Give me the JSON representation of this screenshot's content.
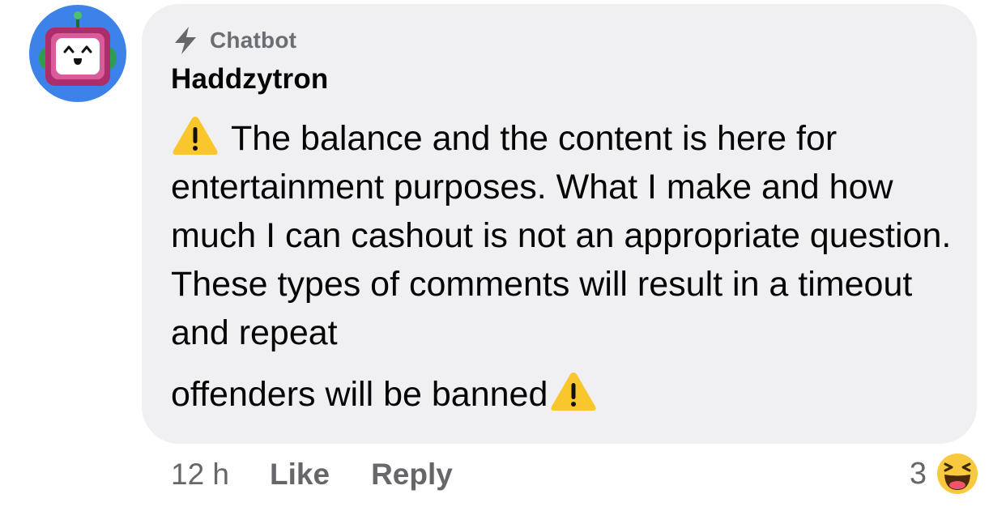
{
  "comment": {
    "badge_icon": "lightning-bolt-icon",
    "badge_label": "Chatbot",
    "author": "Haddzytron",
    "avatar_icon": "robot-avatar",
    "body_lead_icon": "warning-icon",
    "body_text": "The balance and the content is here for entertainment purposes. What I make and how much I can cashout is not an appropriate question. These types of comments will result in a timeout and repeat",
    "body_last_line": "offenders will be banned",
    "body_trail_icon": "warning-icon",
    "timestamp": "12 h",
    "like_label": "Like",
    "reply_label": "Reply",
    "reaction_count": "3",
    "reaction_icon": "haha-emoji-icon"
  },
  "colors": {
    "bubble_bg": "#f0f0f3",
    "text": "#050505",
    "secondary_text": "#65676b",
    "avatar_bg": "#3d82e8",
    "warning_yellow": "#f9c62b"
  }
}
